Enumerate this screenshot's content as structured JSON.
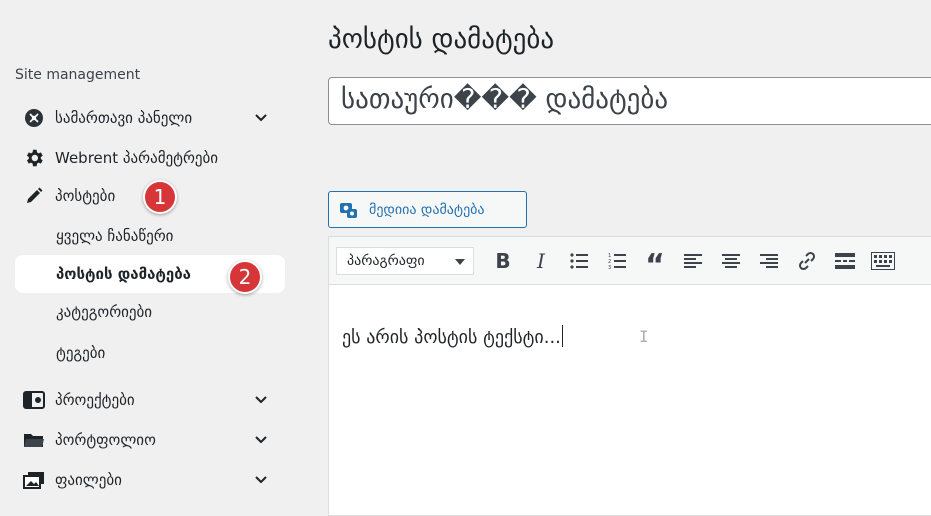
{
  "sidebar": {
    "heading": "Site management",
    "items": [
      {
        "label": "სამართავი პანელი",
        "icon": "dashboard-icon",
        "has_chevron": true
      },
      {
        "label": "Webrent პარამეტრები",
        "icon": "gear-icon",
        "has_chevron": false
      },
      {
        "label": "პოსტები",
        "icon": "pencil-icon",
        "has_chevron": false,
        "badge": "1"
      },
      {
        "label": "პროექტები",
        "icon": "projects-icon",
        "has_chevron": true
      },
      {
        "label": "პორტფოლიო",
        "icon": "folder-icon",
        "has_chevron": true
      },
      {
        "label": "ფაილები",
        "icon": "media-icon",
        "has_chevron": true
      }
    ],
    "sub_items": [
      {
        "label": "ყველა ჩანაწერი",
        "active": false
      },
      {
        "label": "პოსტის დამატება",
        "active": true,
        "badge": "2"
      },
      {
        "label": "კატეგორიები",
        "active": false
      },
      {
        "label": "ტეგები",
        "active": false
      }
    ]
  },
  "main": {
    "title": "პოსტის დამატება",
    "title_input_placeholder": "სათაური��� დამატება",
    "media_button": "მედიია დამატება",
    "format_select": "პარაგრაფი",
    "editor_text": "ეს არის პოსტის ტექსტი..."
  },
  "toolbar": [
    "bold-icon",
    "italic-icon",
    "bullet-list-icon",
    "numbered-list-icon",
    "blockquote-icon",
    "align-left-icon",
    "align-center-icon",
    "align-right-icon",
    "link-icon",
    "read-more-icon",
    "keyboard-icon"
  ],
  "colors": {
    "accent": "#2271b1",
    "badge": "#d63638",
    "background": "#f0f0f1"
  }
}
